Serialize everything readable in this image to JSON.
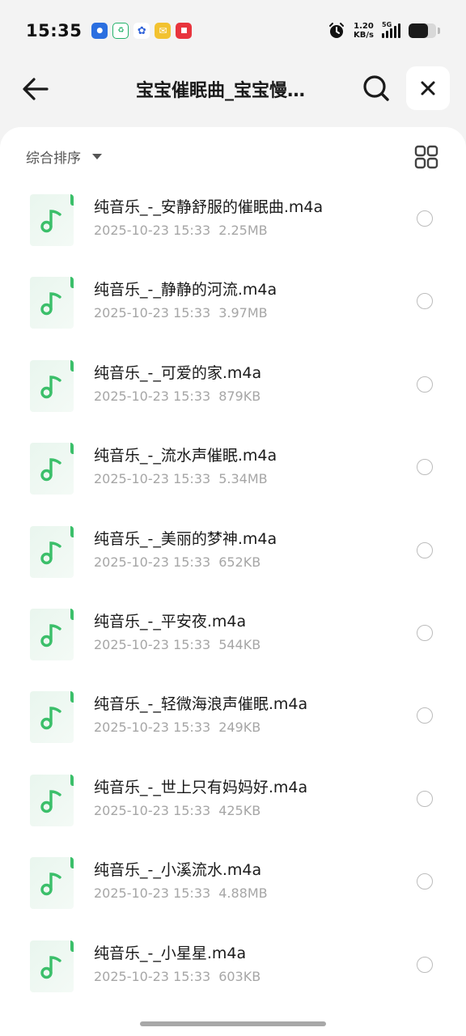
{
  "status_bar": {
    "time": "15:35",
    "network_speed_value": "1.20",
    "network_speed_unit": "KB/s",
    "network_type": "5G",
    "battery_level": 0.72,
    "notifications": [
      {
        "icon": "map-app-icon",
        "color": "#2b6fe0"
      },
      {
        "icon": "recycle-app-icon",
        "color": "#23b26a"
      },
      {
        "icon": "baidu-app-icon",
        "color": "#2f62d9"
      },
      {
        "icon": "mail-app-icon",
        "color": "#f2c230"
      },
      {
        "icon": "news-app-icon",
        "color": "#e8343d"
      }
    ]
  },
  "header": {
    "title": "宝宝催眠曲_宝宝慢…"
  },
  "toolbar": {
    "sort_label": "综合排序"
  },
  "files": [
    {
      "name": "纯音乐_-_安静舒服的催眠曲.m4a",
      "date": "2025-10-23 15:33",
      "size": "2.25MB"
    },
    {
      "name": "纯音乐_-_静静的河流.m4a",
      "date": "2025-10-23 15:33",
      "size": "3.97MB"
    },
    {
      "name": "纯音乐_-_可爱的家.m4a",
      "date": "2025-10-23 15:33",
      "size": "879KB"
    },
    {
      "name": "纯音乐_-_流水声催眠.m4a",
      "date": "2025-10-23 15:33",
      "size": "5.34MB"
    },
    {
      "name": "纯音乐_-_美丽的梦神.m4a",
      "date": "2025-10-23 15:33",
      "size": "652KB"
    },
    {
      "name": "纯音乐_-_平安夜.m4a",
      "date": "2025-10-23 15:33",
      "size": "544KB"
    },
    {
      "name": "纯音乐_-_轻微海浪声催眠.m4a",
      "date": "2025-10-23 15:33",
      "size": "249KB"
    },
    {
      "name": "纯音乐_-_世上只有妈妈好.m4a",
      "date": "2025-10-23 15:33",
      "size": "425KB"
    },
    {
      "name": "纯音乐_-_小溪流水.m4a",
      "date": "2025-10-23 15:33",
      "size": "4.88MB"
    },
    {
      "name": "纯音乐_-_小星星.m4a",
      "date": "2025-10-23 15:33",
      "size": "603KB"
    }
  ],
  "colors": {
    "accent_green": "#3bbf6a",
    "background": "#f3f3f3"
  }
}
